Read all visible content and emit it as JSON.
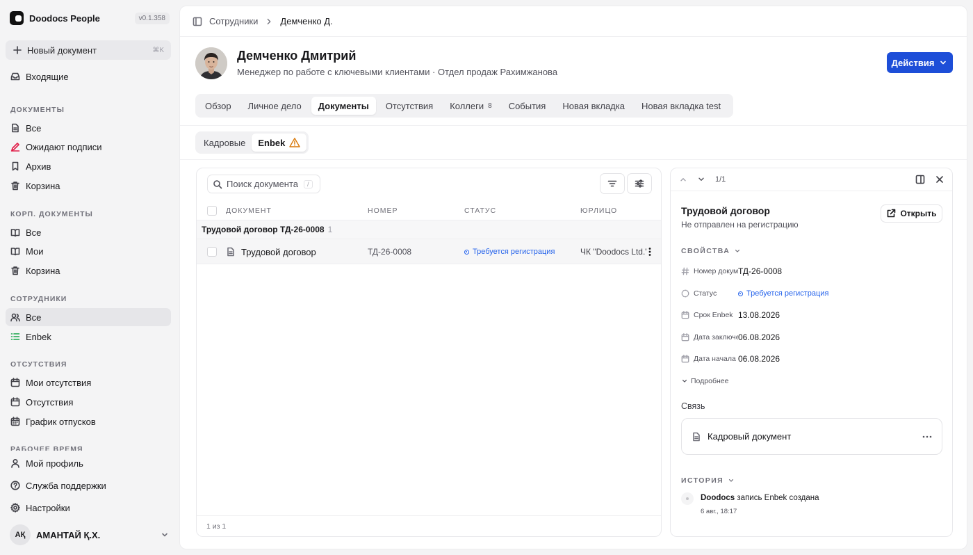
{
  "app": {
    "name": "Doodocs People",
    "version": "v0.1.358"
  },
  "sidebar": {
    "new_doc": {
      "label": "Новый документ",
      "shortcut": "⌘K"
    },
    "inbox": "Входящие",
    "sections": {
      "documents": {
        "title": "ДОКУМЕНТЫ",
        "items": [
          "Все",
          "Ожидают подписи",
          "Архив",
          "Корзина"
        ]
      },
      "corp": {
        "title": "КОРП. ДОКУМЕНТЫ",
        "items": [
          "Все",
          "Мои",
          "Корзина"
        ]
      },
      "employees": {
        "title": "СОТРУДНИКИ",
        "items": [
          "Все",
          "Enbek"
        ]
      },
      "absences": {
        "title": "ОТСУТСТВИЯ",
        "items": [
          "Мои отсутствия",
          "Отсутствия",
          "График отпусков"
        ]
      },
      "worktime": {
        "title": "РАБОЧЕЕ ВРЕМЯ"
      }
    },
    "bottom": [
      "Мой профиль",
      "Служба поддержки",
      "Настройки"
    ],
    "user": {
      "initials": "AҚ",
      "name": "АМАНТАЙ Қ.Х."
    }
  },
  "breadcrumb": {
    "parent": "Сотрудники",
    "current": "Демченко Д."
  },
  "employee": {
    "name": "Демченко Дмитрий",
    "subtitle": "Менеджер по работе с ключевыми клиентами · Отдел продаж Рахимжанова"
  },
  "actions_label": "Действия",
  "tabs": [
    {
      "label": "Обзор"
    },
    {
      "label": "Личное дело"
    },
    {
      "label": "Документы",
      "active": true
    },
    {
      "label": "Отсутствия"
    },
    {
      "label": "Коллеги",
      "count": "8"
    },
    {
      "label": "События"
    },
    {
      "label": "Новая вкладка"
    },
    {
      "label": "Новая вкладка test"
    }
  ],
  "subtabs": [
    "Кадровые",
    "Enbek"
  ],
  "table": {
    "search_placeholder": "Поиск документа",
    "search_shortcut": "/",
    "columns": [
      "ДОКУМЕНТ",
      "НОМЕР",
      "СТАТУС",
      "ЮРЛИЦО"
    ],
    "group": {
      "title": "Трудовой договор ТД-26-0008",
      "count": "1"
    },
    "rows": [
      {
        "document": "Трудовой договор",
        "number": "ТД-26-0008",
        "status": "Требуется регистрация",
        "entity": "ЧК \"Doodocs Ltd.\""
      }
    ],
    "footer": "1 из 1"
  },
  "detail": {
    "pager": "1/1",
    "title": "Трудовой договор",
    "subtitle": "Не отправлен на регистрацию",
    "open_label": "Открыть",
    "properties_title": "СВОЙСТВА",
    "properties": [
      {
        "key": "Номер документа",
        "value": "ТД-26-0008",
        "icon": "hash-icon"
      },
      {
        "key": "Статус",
        "value": "Требуется регистрация",
        "icon": "status-icon"
      },
      {
        "key": "Срок Enbek",
        "value": "13.08.2026",
        "icon": "calendar-icon"
      },
      {
        "key": "Дата заключения",
        "value": "06.08.2026",
        "icon": "calendar-icon"
      },
      {
        "key": "Дата начала",
        "value": "06.08.2026",
        "icon": "calendar-icon"
      }
    ],
    "more_label": "Подробнее",
    "link_title": "Связь",
    "link_card": "Кадровый документ",
    "history_title": "ИСТОРИЯ",
    "history": {
      "actor": "Doodocs",
      "text": "запись Enbek создана",
      "date": "6 авг., 18:17"
    }
  },
  "colors": {
    "accent": "#1d4ed8",
    "status_blue": "#2563eb",
    "sign_red": "#e11d48",
    "enbek_green": "#16a34a",
    "warning": "#d97706"
  }
}
